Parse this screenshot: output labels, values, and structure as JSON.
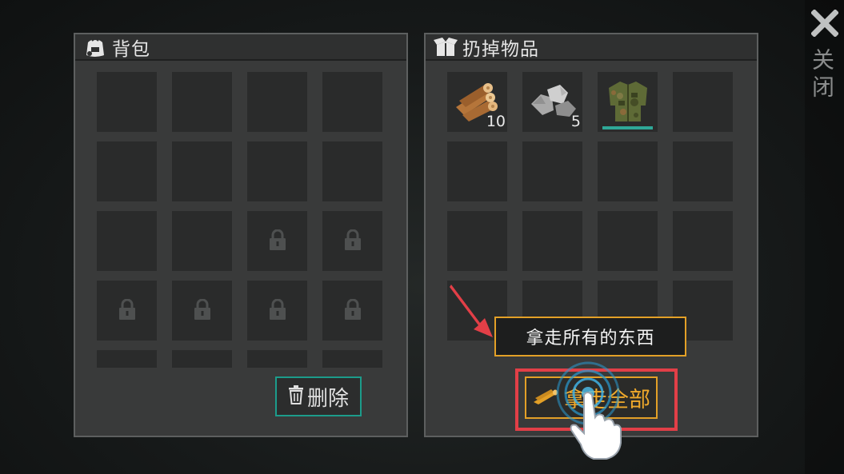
{
  "close": {
    "label": "关闭",
    "icon": "close-x-icon"
  },
  "backpack": {
    "title": "背包",
    "icon": "backpack-icon",
    "delete_label": "删除",
    "delete_icon": "trash-icon",
    "locked_slots": [
      10,
      11,
      12,
      13,
      14,
      15
    ]
  },
  "drop": {
    "title": "扔掉物品",
    "icon": "open-box-icon",
    "items": [
      {
        "name": "wood-logs",
        "icon": "wood-logs-icon",
        "count": "10"
      },
      {
        "name": "stones",
        "icon": "stones-icon",
        "count": "5"
      },
      {
        "name": "camo-jacket",
        "icon": "jacket-icon",
        "count": "",
        "durability": 1.0
      }
    ],
    "take_all_label": "拿走全部",
    "take_all_icon": "wood-logs-icon"
  },
  "tutorial": {
    "tooltip": "拿走所有的东西",
    "hand_icon": "pointing-hand-icon",
    "arrow_icon": "red-arrow-icon",
    "highlight_color": "#e23f47"
  },
  "colors": {
    "accent_orange": "#e3a027",
    "accent_teal": "#1c9c8b",
    "slot_bg": "#2a2b2b",
    "panel_bg": "#393a3a"
  }
}
